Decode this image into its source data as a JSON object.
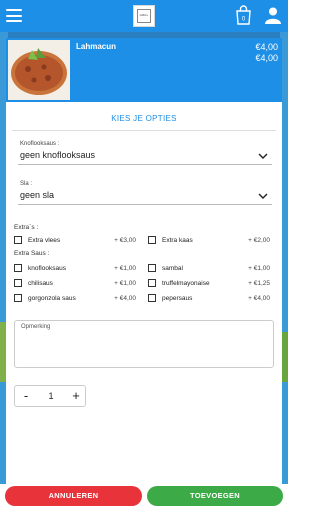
{
  "header": {
    "menu_icon": "hamburger-icon",
    "logo_text": "GRILL",
    "cart_icon": "shopping-bag-icon",
    "cart_count": "0",
    "user_icon": "user-icon",
    "color": "#1e8fe6"
  },
  "product": {
    "name": "Lahmacun",
    "price_1": "€4,00",
    "price_2": "€4,00"
  },
  "options": {
    "title": "KIES JE OPTIES",
    "knoflooksaus": {
      "label": "Knoflooksaus :",
      "value": "geen knoflooksaus"
    },
    "sla": {
      "label": "Sla :",
      "value": "geen sla"
    },
    "extras_label": "Extra`s :",
    "extras": [
      {
        "label": "Extra vlees",
        "price": "+ €3,00",
        "checked": false
      },
      {
        "label": "Extra kaas",
        "price": "+ €2,00",
        "checked": false
      }
    ],
    "extra_saus_label": "Extra Saus :",
    "sauces": [
      {
        "label": "knoflooksaus",
        "price": "+ €1,00",
        "checked": false
      },
      {
        "label": "sambal",
        "price": "+ €1,00",
        "checked": false
      },
      {
        "label": "chilisaus",
        "price": "+ €1,00",
        "checked": false
      },
      {
        "label": "truffelmayonaise",
        "price": "+ €1,25",
        "checked": false
      },
      {
        "label": "gorgonzola saus",
        "price": "+ €4,00",
        "checked": false
      },
      {
        "label": "pepersaus",
        "price": "+ €4,00",
        "checked": false
      }
    ],
    "remark_label": "Opmerking",
    "quantity": "1",
    "minus": "-",
    "plus": "+"
  },
  "actions": {
    "cancel_label": "ANNULEREN",
    "add_label": "TOEVOEGEN",
    "cancel_color": "#e8333a",
    "add_color": "#3daa48"
  }
}
